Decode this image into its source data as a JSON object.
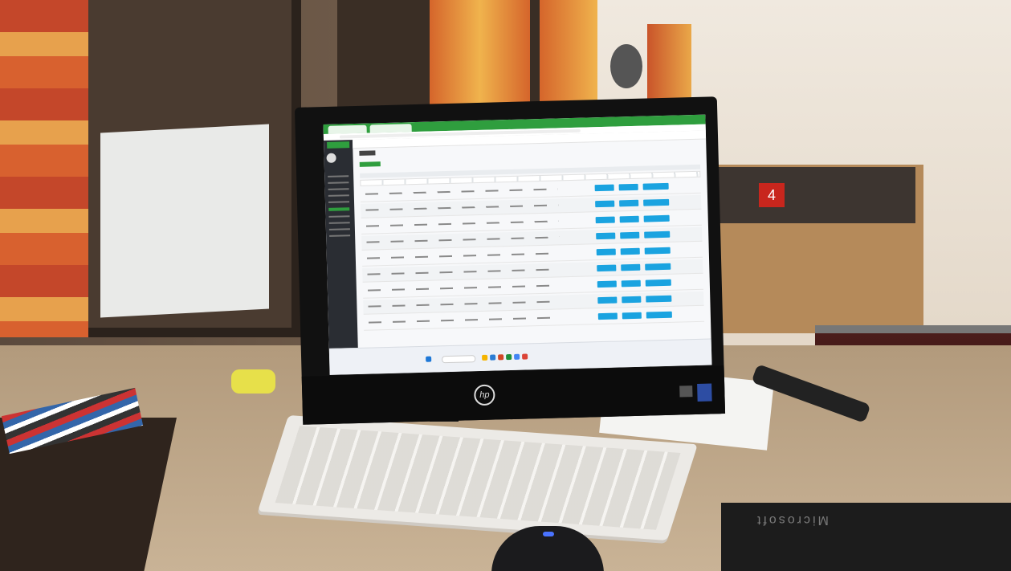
{
  "scene": {
    "room_sign": "4",
    "mousepad_text": "Microsoft"
  },
  "colors": {
    "browser_accent": "#2f9e3e",
    "row_button": "#1aa3e0",
    "sidebar": "#2a2d33"
  },
  "monitor": {
    "brand_logo": "hp"
  },
  "screen": {
    "table_rows": 9,
    "row_buttons_per_row": 3
  }
}
